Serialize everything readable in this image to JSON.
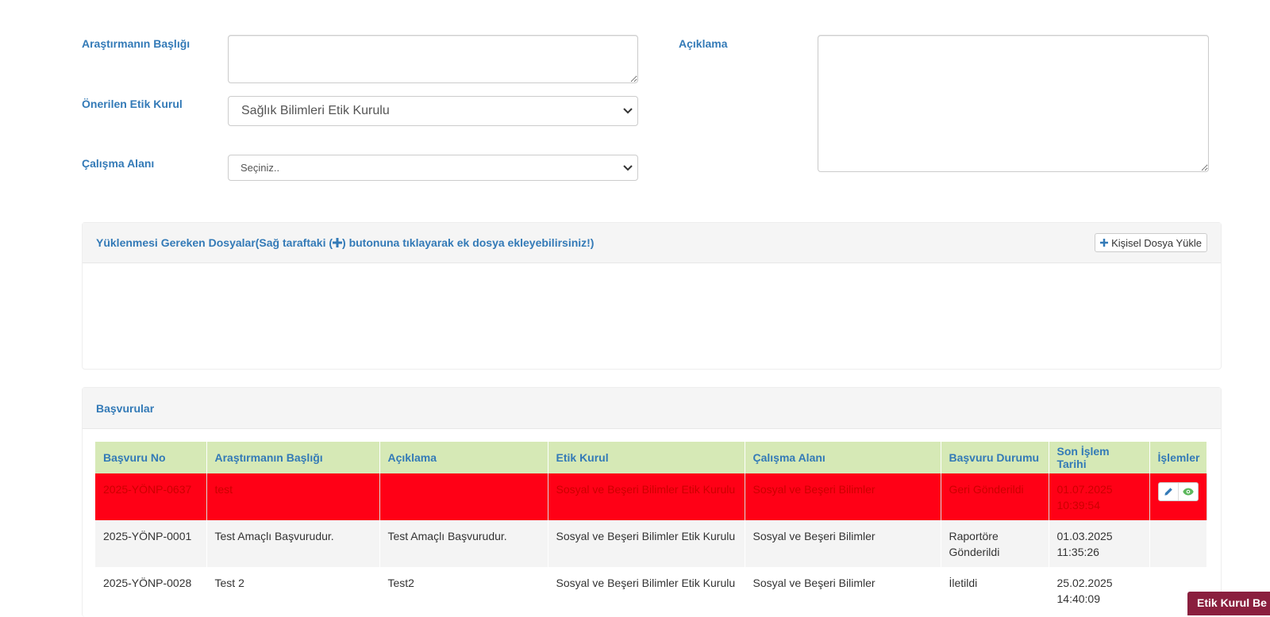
{
  "form": {
    "title_label": "Araştırmanın Başlığı",
    "title_value": "",
    "committee_label": "Önerilen Etik Kurul",
    "committee_selected": "Sağlık Bilimleri Etik Kurulu",
    "field_label": "Çalışma Alanı",
    "field_selected": "Seçiniz..",
    "description_label": "Açıklama",
    "description_value": ""
  },
  "files_panel": {
    "title_before": "Yüklenmesi Gereken Dosyalar(Sağ taraftaki (",
    "title_after": ") butonuna tıklayarak ek dosya ekleyebilirsiniz!)",
    "upload_button": "Kişisel Dosya Yükle"
  },
  "applications_panel": {
    "title": "Başvurular",
    "columns": [
      "Başvuru No",
      "Araştırmanın Başlığı",
      "Açıklama",
      "Etik Kurul",
      "Çalışma Alanı",
      "Başvuru Durumu",
      "Son İşlem Tarihi",
      "İşlemler"
    ],
    "rows": [
      {
        "no": "2025-YÖNP-0637",
        "title": "test",
        "description": "",
        "committee": "Sosyal ve Beşeri Bilimler Etik Kurulu",
        "field": "Sosyal ve Beşeri Bilimler",
        "status": "Geri Gönderildi",
        "date": "01.07.2025 10:39:54"
      },
      {
        "no": "2025-YÖNP-0001",
        "title": "Test Amaçlı Başvurudur.",
        "description": "Test Amaçlı Başvurudur.",
        "committee": "Sosyal ve Beşeri Bilimler Etik Kurulu",
        "field": "Sosyal ve Beşeri Bilimler",
        "status": "Raportöre Gönderildi",
        "date": "01.03.2025 11:35:26"
      },
      {
        "no": "2025-YÖNP-0028",
        "title": "Test 2",
        "description": "Test2",
        "committee": "Sosyal ve Beşeri Bilimler Etik Kurulu",
        "field": "Sosyal ve Beşeri Bilimler",
        "status": "İletildi",
        "date": "25.02.2025 14:40:09"
      }
    ]
  },
  "corner_tab": "Etik Kurul Be",
  "icons": {
    "plus": "plus-icon",
    "edit": "pencil-icon",
    "view": "eye-icon",
    "dropdown": "chevron-down-icon"
  },
  "colors": {
    "accent": "#337ab7",
    "header_green": "#d6e9b6",
    "returned_row": "#ff0016",
    "edit_icon": "#337ab7",
    "view_icon": "#5cb85c",
    "corner_tab": "#8a1f3e"
  }
}
